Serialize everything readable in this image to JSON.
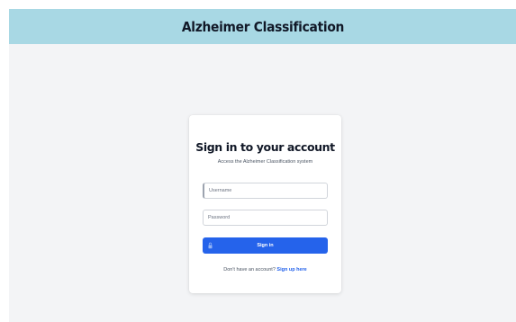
{
  "header": {
    "title": "Alzheimer Classification"
  },
  "login_card": {
    "title": "Sign in to your account",
    "subtitle": "Access the Alzheimer Classification system",
    "username": {
      "placeholder": "Username",
      "value": ""
    },
    "password": {
      "placeholder": "Password",
      "value": ""
    },
    "submit_label": "Sign in",
    "submit_icon": "lock-icon",
    "signup_prompt": "Don't have an account?",
    "signup_link_label": "Sign up here"
  },
  "colors": {
    "header_background": "#a8d8e4",
    "page_background": "#f3f4f6",
    "primary": "#2563eb",
    "card_background": "#ffffff"
  }
}
